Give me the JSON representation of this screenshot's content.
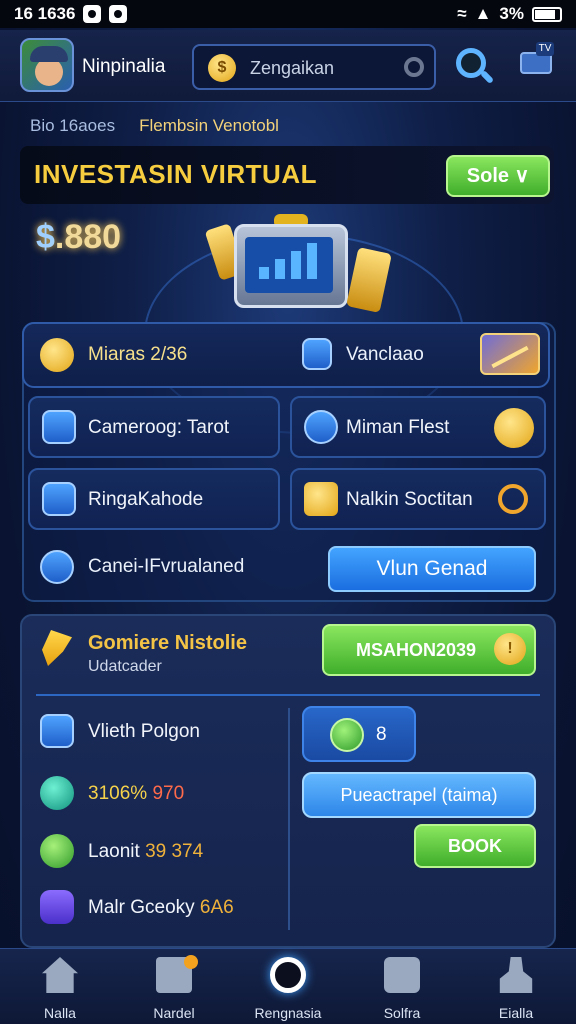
{
  "status_bar": {
    "time": "16 1636",
    "battery": "3%"
  },
  "header": {
    "username": "Ninpinalia",
    "search": {
      "text": "Zengaikan"
    }
  },
  "breadcrumbs": [
    "Bio 16aoes",
    "Flembsin Venotobl"
  ],
  "banner": {
    "title": "INVESTASIN VIRTUAL",
    "button_label": "Sole ∨"
  },
  "balance": {
    "currency": "$",
    "amount": ".880"
  },
  "grid": {
    "row1": {
      "left_label": "Miaras 2/36",
      "right_label": "Vanclaao"
    },
    "tiles": [
      {
        "label": "Cameroog: Tarot"
      },
      {
        "label": "Miman Flest"
      },
      {
        "label": "RingaKahode"
      },
      {
        "label": "Nalkin Soctitan"
      }
    ],
    "row4_label": "Canei-IFvrualaned",
    "wide_button": "Vlun Genad"
  },
  "section": {
    "title": "Gomiere Nistolie",
    "subtitle": "Udatcader",
    "promo_button": "MSAHON2039",
    "promo_coin": "!",
    "list": [
      {
        "label": "Vlieth Polgon",
        "value": ""
      },
      {
        "label": "3106%",
        "value": "970",
        "value_color": "#ff6b4a"
      },
      {
        "label": "Laonit",
        "value": "39 374",
        "value_color": "#f0b23a"
      },
      {
        "label": "Malr Gceoky",
        "value": "6A6",
        "value_color": "#f0b23a"
      }
    ],
    "chip_value": "8",
    "blue_button": "Pueactrapel (taima)",
    "book_button": "BOOK"
  },
  "nav": [
    {
      "label": "Nalla",
      "icon": "home-icon"
    },
    {
      "label": "Nardel",
      "icon": "document-icon"
    },
    {
      "label": "Rengnasia",
      "icon": "circle-icon"
    },
    {
      "label": "Solfra",
      "icon": "bars-icon"
    },
    {
      "label": "Eialla",
      "icon": "user-icon"
    }
  ],
  "colors": {
    "accent_gold": "#f6cd3f",
    "accent_blue": "#2e86e8",
    "accent_green": "#3fae2b"
  }
}
